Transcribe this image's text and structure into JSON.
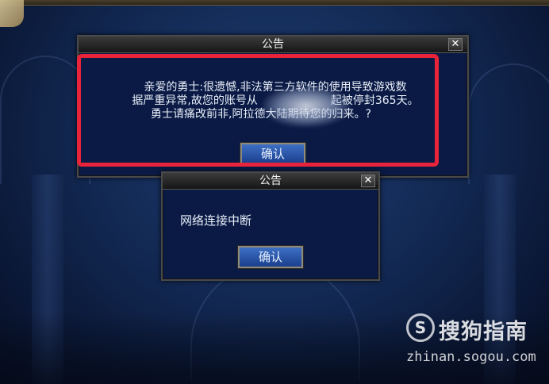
{
  "dialog_main": {
    "title": "公告",
    "close_glyph": "✕",
    "message_line1": "亲爱的勇士:很遗憾,非法第三方软件的使用导致游戏数",
    "message_line2": "据严重异常,故您的账号从",
    "message_line2_end": "起被停封365天。",
    "message_line3": "勇士请痛改前非,阿拉德大陆期待您的归来。?",
    "confirm_label": "确认"
  },
  "dialog_secondary": {
    "title": "公告",
    "close_glyph": "✕",
    "message": "网络连接中断",
    "confirm_label": "确认"
  },
  "watermark": {
    "logo_glyph": "S",
    "brand": "搜狗指南",
    "url": "zhinan.sogou.com"
  },
  "colors": {
    "highlight_border": "#e8233a",
    "dialog_bg": "#0a1a45",
    "button_bg": "#2856a8"
  }
}
